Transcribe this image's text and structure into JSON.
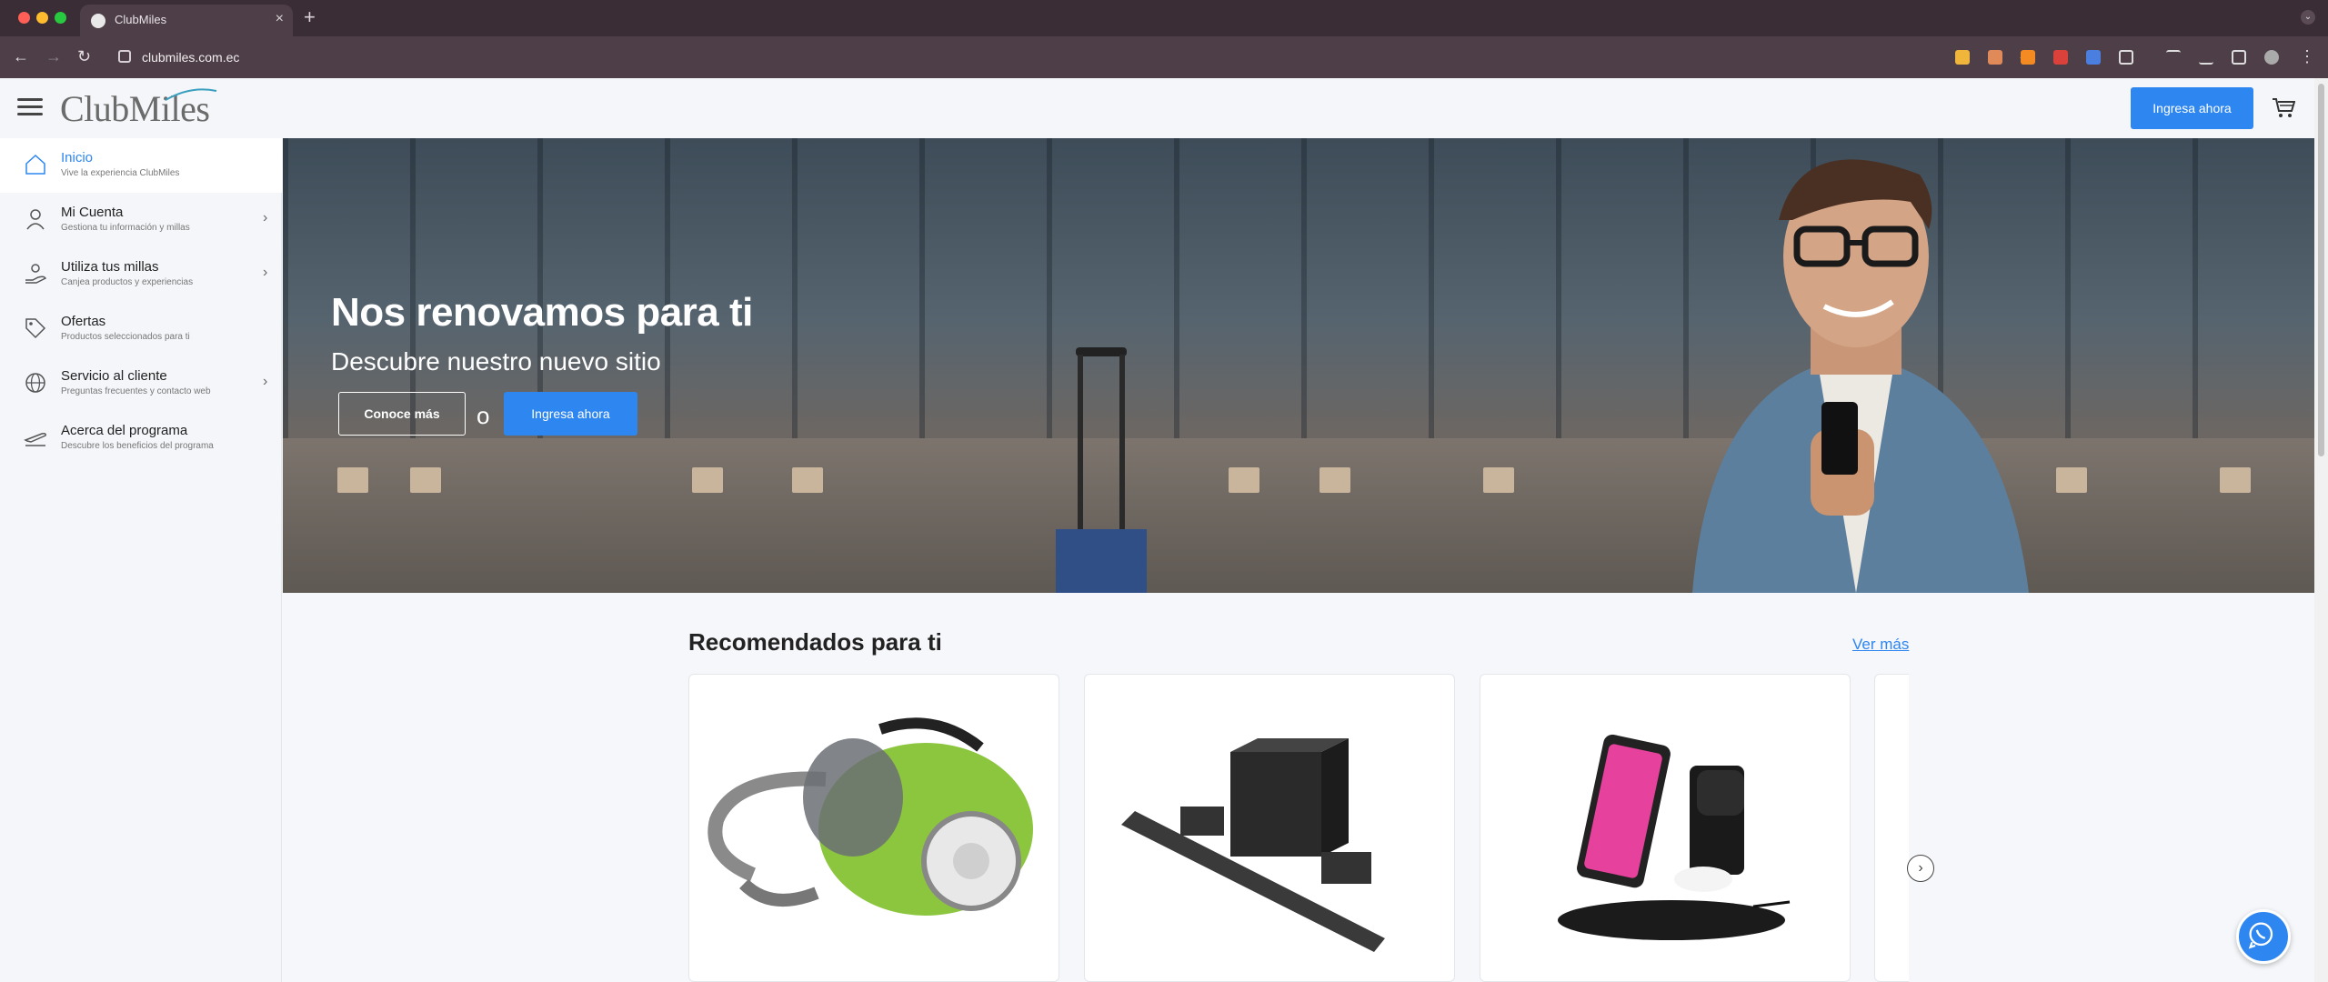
{
  "browser": {
    "tab_title": "ClubMiles",
    "url": "clubmiles.com.ec",
    "new_tab_symbol": "+",
    "close_symbol": "×"
  },
  "header": {
    "logo_text": "ClubMiles",
    "login_button": "Ingresa ahora"
  },
  "sidebar": {
    "items": [
      {
        "label": "Inicio",
        "sub": "Vive la experiencia ClubMiles",
        "icon": "home-icon",
        "active": true,
        "chevron": false
      },
      {
        "label": "Mi Cuenta",
        "sub": "Gestiona tu información y millas",
        "icon": "user-icon",
        "active": false,
        "chevron": true
      },
      {
        "label": "Utiliza tus millas",
        "sub": "Canjea productos y experiencias",
        "icon": "redeem-hand-icon",
        "active": false,
        "chevron": true
      },
      {
        "label": "Ofertas",
        "sub": "Productos seleccionados para ti",
        "icon": "tag-icon",
        "active": false,
        "chevron": false
      },
      {
        "label": "Servicio al cliente",
        "sub": "Preguntas frecuentes y contacto web",
        "icon": "globe-icon",
        "active": false,
        "chevron": true
      },
      {
        "label": "Acerca del programa",
        "sub": "Descubre los beneficios del programa",
        "icon": "plane-icon",
        "active": false,
        "chevron": false
      }
    ]
  },
  "hero": {
    "title": "Nos renovamos para ti",
    "subtitle": "Descubre nuestro nuevo sitio",
    "button_secondary": "Conoce más",
    "separator": "o",
    "button_primary": "Ingresa ahora"
  },
  "recommended": {
    "title": "Recomendados para ti",
    "see_more": "Ver más",
    "products": [
      {
        "name": "vacuum-cleaner",
        "image": "green canister vacuum"
      },
      {
        "name": "soundbar-system",
        "image": "soundbar with subwoofer and speakers"
      },
      {
        "name": "wireless-charging-station",
        "image": "3-in-1 wireless charger with phone and watch"
      }
    ]
  },
  "colors": {
    "accent": "#2e86f0",
    "chrome_dark": "#3b2d35",
    "chrome_toolbar": "#4d3e47"
  }
}
